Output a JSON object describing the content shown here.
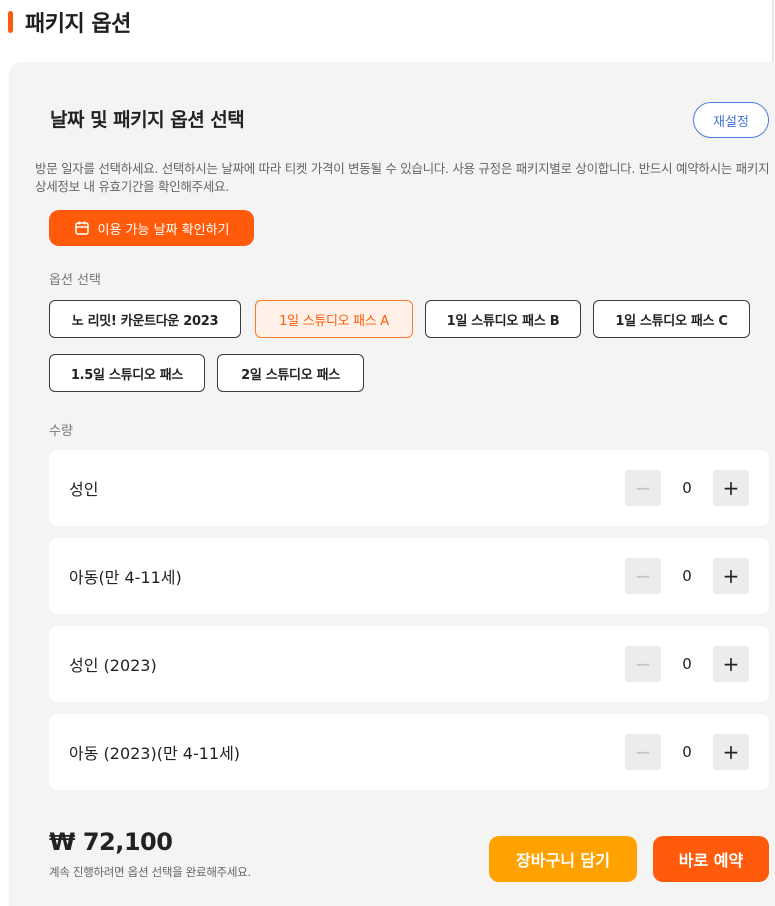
{
  "section": {
    "title": "패키지 옵션"
  },
  "panel": {
    "heading": "날짜 및 패키지 옵션 선택",
    "reset_label": "재설정",
    "description": "방문 일자를 선택하세요. 선택하시는 날짜에 따라 티켓 가격이 변동될 수 있습니다. 사용 규정은 패키지별로 상이합니다. 반드시 예약하시는 패키지 상세정보 내 유효기간을 확인해주세요.",
    "date_button_label": "이용 가능 날짜 확인하기"
  },
  "options": {
    "label": "옵션 선택",
    "items": [
      {
        "label": "노 리밋! 카운트다운 2023",
        "selected": false
      },
      {
        "label": "1일 스튜디오 패스 A",
        "selected": true
      },
      {
        "label": "1일 스튜디오 패스 B",
        "selected": false
      },
      {
        "label": "1일 스튜디오 패스 C",
        "selected": false
      },
      {
        "label": "1.5일 스튜디오 패스",
        "selected": false
      },
      {
        "label": "2일 스튜디오 패스",
        "selected": false
      }
    ]
  },
  "quantity": {
    "label": "수량",
    "rows": [
      {
        "label": "성인",
        "value": "0"
      },
      {
        "label": "아동(만 4-11세)",
        "value": "0"
      },
      {
        "label": "성인 (2023)",
        "value": "0"
      },
      {
        "label": "아동 (2023)(만 4-11세)",
        "value": "0"
      }
    ],
    "minus_symbol": "−",
    "plus_symbol": "+"
  },
  "footer": {
    "price": "₩ 72,100",
    "note": "계속 진행하려면 옵션 선택을 완료해주세요.",
    "cart_label": "장바구니 담기",
    "book_label": "바로 예약"
  },
  "colors": {
    "accent": "#ff5b0a",
    "cart": "#ffa200",
    "reset": "#3f74d8"
  },
  "icons": {
    "date_button": "calendar-icon"
  }
}
